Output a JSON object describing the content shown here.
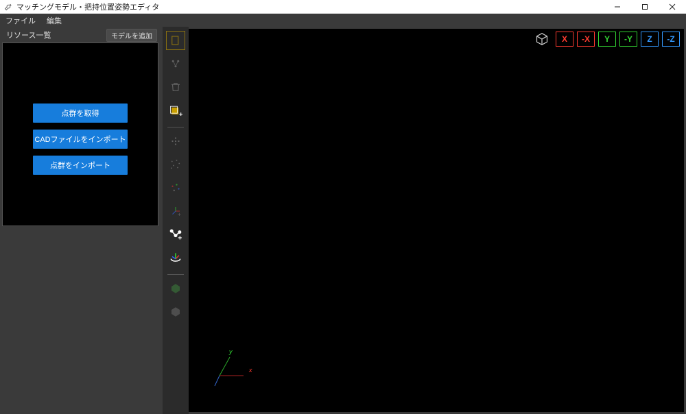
{
  "window": {
    "title": "マッチングモデル・把持位置姿勢エディタ"
  },
  "menu": {
    "file": "ファイル",
    "edit": "編集"
  },
  "panel": {
    "title": "リソース一覧",
    "add_model": "モデルを追加",
    "btn_capture_pc": "点群を取得",
    "btn_import_cad": "CADファイルをインポート",
    "btn_import_pc": "点群をインポート"
  },
  "toolbar": {
    "items": [
      {
        "name": "select-rect-icon",
        "active": false,
        "selected": true
      },
      {
        "name": "link-chain-icon",
        "active": false,
        "selected": false
      },
      {
        "name": "trash-icon",
        "active": false,
        "selected": false
      },
      {
        "name": "box-add-icon",
        "active": true,
        "selected": false
      },
      {
        "name": "sep"
      },
      {
        "name": "points-cluster-icon",
        "active": false,
        "selected": false
      },
      {
        "name": "points-scatter-icon",
        "active": false,
        "selected": false
      },
      {
        "name": "points-color-icon",
        "active": false,
        "selected": false
      },
      {
        "name": "frame-axis-icon",
        "active": false,
        "selected": false
      },
      {
        "name": "path-add-icon",
        "active": true,
        "selected": false
      },
      {
        "name": "orbit-icon",
        "active": true,
        "selected": false
      },
      {
        "name": "sep"
      },
      {
        "name": "hex-green-icon",
        "active": false,
        "selected": false
      },
      {
        "name": "hex-grey-icon",
        "active": false,
        "selected": false
      }
    ]
  },
  "axis": {
    "x": "X",
    "nx": "-X",
    "y": "Y",
    "ny": "-Y",
    "z": "Z",
    "nz": "-Z"
  },
  "gizmo": {
    "x": "x",
    "y": "y"
  }
}
